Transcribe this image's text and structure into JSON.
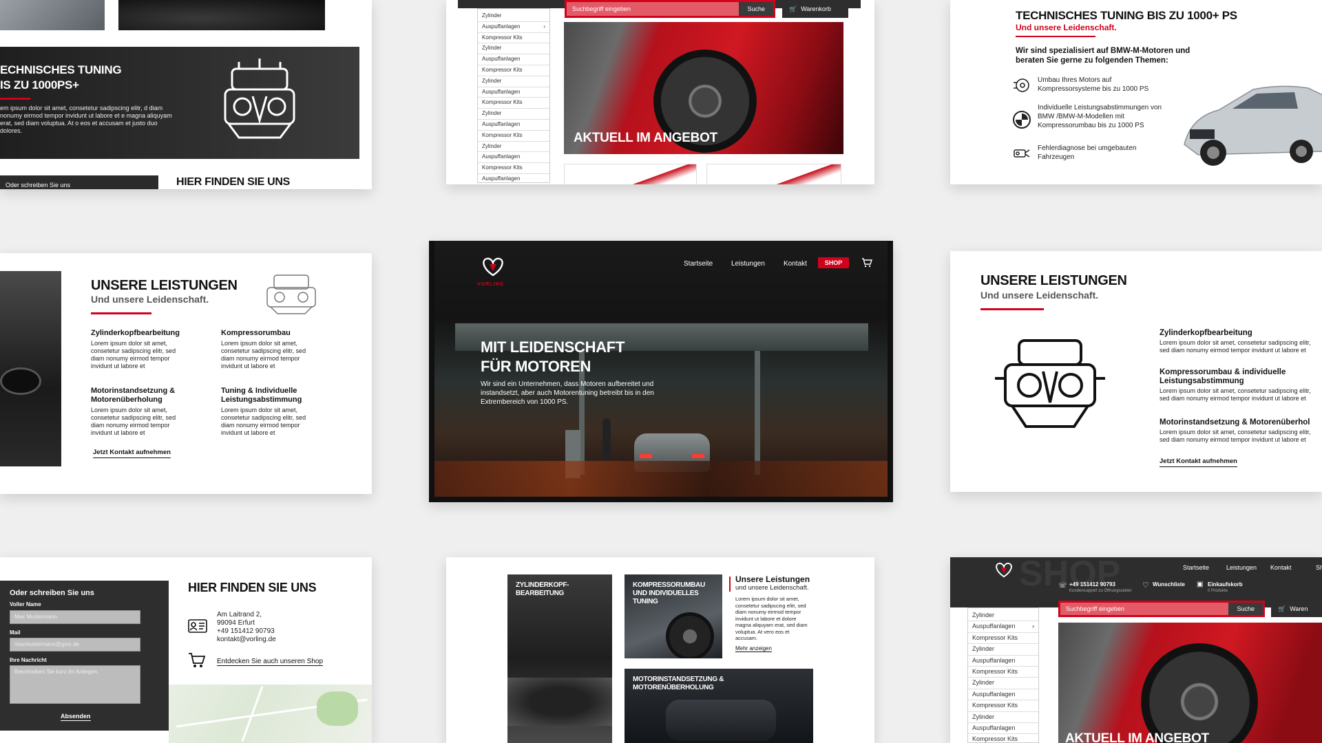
{
  "hero": {
    "nav": [
      "Startseite",
      "Leistungen",
      "Kontakt"
    ],
    "shop_label": "SHOP",
    "brand": "VORLING",
    "title_line1": "MIT LEIDENSCHAFT",
    "title_line2": "FÜR MOTOREN",
    "text": "Wir sind ein Unternehmen, dass Motoren aufbereitet und instandsetzt, aber auch Motorentuning betreibt bis in den Extrembereich von 1000 PS."
  },
  "tuning_dark": {
    "title_line1": "ECHNISCHES TUNING",
    "title_line2": "IS ZU 1000PS+",
    "text": "em ipsum dolor sit amet, consetetur sadipscing elitr, d diam nonumy eirmod tempor invidunt ut labore et e magna aliquyam erat, sed diam voluptua. At o eos et accusam et justo duo dolores.",
    "bottom_tab": "Oder schreiben Sie uns",
    "bottom_title": "HIER FINDEN SIE UNS"
  },
  "shop_top": {
    "search_placeholder": "Suchbegriff eingeben",
    "search_button": "Suche",
    "cart": "Warenkorb",
    "categories": [
      "Zylinder",
      "Auspuffanlagen",
      "Kompressor Kits",
      "Zylinder",
      "Auspuffanlagen",
      "Kompressor Kits",
      "Zylinder",
      "Auspuffanlagen",
      "Kompressor Kits",
      "Zylinder",
      "Auspuffanlagen",
      "Kompressor Kits",
      "Zylinder",
      "Auspuffanlagen",
      "Kompressor Kits",
      "Auspuffanlagen"
    ],
    "banner": "AKTUELL IM ANGEBOT"
  },
  "tuning_light": {
    "title": "TECHNISCHES TUNING BIS ZU 1000+ PS",
    "subtitle": "Und unsere Leidenschaft.",
    "intro": "Wir sind spezialisiert auf BMW-M-Motoren und beraten Sie gerne zu folgenden Themen:",
    "items": [
      "Umbau Ihres Motors auf Kompressorsysteme bis zu 1000 PS",
      "Individuelle Leistungsabstimmungen von BMW /BMW-M-Modellen mit Kompressorumbau bis zu 1000 PS",
      "Fehlerdiagnose bei umgebauten Fahrzeugen"
    ]
  },
  "services_left": {
    "title": "UNSERE LEISTUNGEN",
    "subtitle": "Und unsere Leidenschaft.",
    "items": [
      {
        "title": "Zylinderkopfbearbeitung",
        "text": "Lorem ipsum dolor sit amet, consetetur sadipscing elitr, sed diam nonumy eirmod tempor invidunt ut labore et"
      },
      {
        "title": "Kompressorumbau",
        "text": "Lorem ipsum dolor sit amet, consetetur sadipscing elitr, sed diam nonumy eirmod tempor invidunt ut labore et"
      },
      {
        "title": "Motorinstandsetzung & Motorenüberholung",
        "text": "Lorem ipsum dolor sit amet, consetetur sadipscing elitr, sed diam nonumy eirmod tempor invidunt ut labore et"
      },
      {
        "title": "Tuning & Individuelle Leistungsabstimmung",
        "text": "Lorem ipsum dolor sit amet, consetetur sadipscing elitr, sed diam nonumy eirmod tempor invidunt ut labore et"
      }
    ],
    "cta": "Jetzt Kontakt aufnehmen"
  },
  "services_right": {
    "title": "UNSERE LEISTUNGEN",
    "subtitle": "Und unsere Leidenschaft.",
    "items": [
      {
        "title": "Zylinderkopfbearbeitung",
        "text": "Lorem ipsum dolor sit amet, consetetur sadipscing elitr, sed diam nonumy eirmod tempor invidunt ut labore et"
      },
      {
        "title": "Kompressorumbau & individuelle Leistungsabstimmung",
        "text": "Lorem ipsum dolor sit amet, consetetur sadipscing elitr, sed diam nonumy eirmod tempor invidunt ut labore et"
      },
      {
        "title": "Motorinstandsetzung & Motorenüberhol",
        "text": "Lorem ipsum dolor sit amet, consetetur sadipscing elitr, sed diam nonumy eirmod tempor invidunt ut labore et"
      }
    ],
    "cta": "Jetzt Kontakt aufnehmen"
  },
  "contact": {
    "form_title": "Oder schreiben Sie uns",
    "name_label": "Voller Name",
    "name_placeholder": "Max Mustermann",
    "mail_label": "Mail",
    "mail_placeholder": "maxmustermann@gmx.de",
    "msg_label": "Ihre Nachricht",
    "msg_placeholder": "Beschreiben Sie kurz Ihr Anliegen.",
    "submit": "Absenden",
    "title": "HIER FINDEN SIE UNS",
    "address": [
      "Am Laitrand 2,",
      "99094 Erfurt",
      "+49 151412 90793",
      "kontakt@vorling.de"
    ],
    "shop_link": "Entdecken Sie auch unseren Shop"
  },
  "tiles": {
    "tile1": "ZYLINDERKOPF-BEARBEITUNG",
    "tile2": "KOMPRESSORUMBAU UND INDIVIDUELLES TUNING",
    "tile3": "MOTORINSTANDSETZUNG & MOTORENÜBERHOLUNG",
    "side_title": "Unsere Leistungen",
    "side_sub": "und unsere Leidenschaft.",
    "side_text": "Lorem ipsum dolor sit amet, consetetur sadipscing elitr, sed diam nonumy eirmod tempor invidunt ut labore et dolore magna aliquyam erat, sed diam voluptua. At vero eos et accusam.",
    "more": "Mehr anzeigen"
  },
  "shop_bottom": {
    "nav": [
      "Startseite",
      "Leistungen",
      "Kontakt",
      "Sh"
    ],
    "phone": "+49 151412 90793",
    "phone_sub": "Kundensupport zu Öffnungszeiten",
    "wishlist": "Wunschliste",
    "basket": "Einkaufskorb",
    "basket_sub": "0 Produkte",
    "search_placeholder": "Suchbegriff eingeben",
    "search_button": "Suche",
    "cart": "Waren",
    "categories": [
      "Zylinder",
      "Auspuffanlagen",
      "Kompressor Kits",
      "Zylinder",
      "Auspuffanlagen",
      "Kompressor Kits",
      "Zylinder",
      "Auspuffanlagen",
      "Kompressor Kits",
      "Zylinder",
      "Auspuffanlagen",
      "Kompressor Kits"
    ],
    "banner": "AKTUELL IM ANGEBOT"
  }
}
